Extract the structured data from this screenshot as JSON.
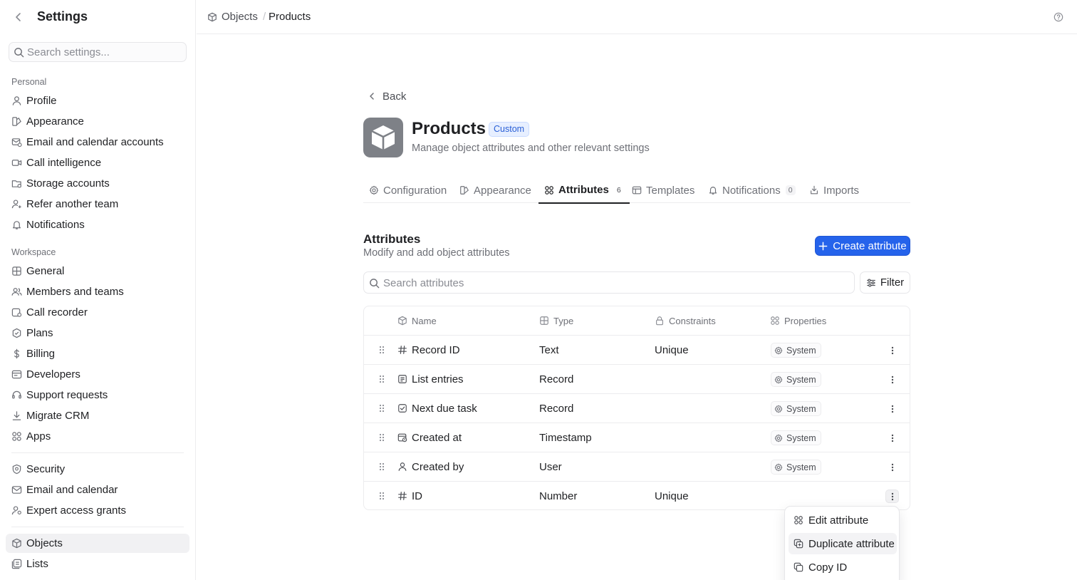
{
  "sidebar": {
    "title": "Settings",
    "search_placeholder": "Search settings...",
    "personal_label": "Personal",
    "workspace_label": "Workspace",
    "personal": [
      {
        "label": "Profile",
        "icon": "user-icon"
      },
      {
        "label": "Appearance",
        "icon": "palette-icon"
      },
      {
        "label": "Email and calendar accounts",
        "icon": "mail-calendar-icon"
      },
      {
        "label": "Call intelligence",
        "icon": "video-icon"
      },
      {
        "label": "Storage accounts",
        "icon": "storage-icon"
      },
      {
        "label": "Refer another team",
        "icon": "user-plus-icon"
      },
      {
        "label": "Notifications",
        "icon": "bell-icon"
      }
    ],
    "workspace": [
      {
        "label": "General",
        "icon": "grid-icon"
      },
      {
        "label": "Members and teams",
        "icon": "users-icon"
      },
      {
        "label": "Call recorder",
        "icon": "recorder-icon"
      },
      {
        "label": "Plans",
        "icon": "badge-icon"
      },
      {
        "label": "Billing",
        "icon": "dollar-icon"
      },
      {
        "label": "Developers",
        "icon": "terminal-icon"
      },
      {
        "label": "Support requests",
        "icon": "headset-icon"
      },
      {
        "label": "Migrate CRM",
        "icon": "download-icon"
      },
      {
        "label": "Apps",
        "icon": "apps-icon"
      }
    ],
    "security": [
      {
        "label": "Security",
        "icon": "shield-icon"
      },
      {
        "label": "Email and calendar",
        "icon": "envelope-icon"
      },
      {
        "label": "Expert access grants",
        "icon": "user-key-icon"
      }
    ],
    "data": [
      {
        "label": "Objects",
        "icon": "cube-icon",
        "active": true
      },
      {
        "label": "Lists",
        "icon": "list-icon"
      }
    ]
  },
  "topbar": {
    "crumb_1": "Objects",
    "crumb_sep": "/",
    "crumb_2": "Products"
  },
  "page": {
    "back": "Back",
    "title": "Products",
    "badge": "Custom",
    "subtitle": "Manage object attributes and other relevant settings",
    "tabs": [
      {
        "label": "Configuration",
        "icon": "gear-icon"
      },
      {
        "label": "Appearance",
        "icon": "palette-icon"
      },
      {
        "label": "Attributes",
        "icon": "attributes-icon",
        "count": "6",
        "active": true
      },
      {
        "label": "Templates",
        "icon": "template-icon"
      },
      {
        "label": "Notifications",
        "icon": "bell-icon",
        "count": "0"
      },
      {
        "label": "Imports",
        "icon": "import-icon"
      }
    ]
  },
  "attributes": {
    "title": "Attributes",
    "subtitle": "Modify and add object attributes",
    "create_label": "Create attribute",
    "search_placeholder": "Search attributes",
    "filter_label": "Filter",
    "columns": {
      "name": "Name",
      "type": "Type",
      "constraints": "Constraints",
      "properties": "Properties"
    },
    "rows": [
      {
        "name": "Record ID",
        "icon": "hash-icon",
        "type": "Text",
        "constraints": "Unique",
        "property": "System"
      },
      {
        "name": "List entries",
        "icon": "list-entry-icon",
        "type": "Record",
        "constraints": "",
        "property": "System"
      },
      {
        "name": "Next due task",
        "icon": "checkbox-icon",
        "type": "Record",
        "constraints": "",
        "property": "System"
      },
      {
        "name": "Created at",
        "icon": "calendar-clock-icon",
        "type": "Timestamp",
        "constraints": "",
        "property": "System"
      },
      {
        "name": "Created by",
        "icon": "user-icon",
        "type": "User",
        "constraints": "",
        "property": "System"
      },
      {
        "name": "ID",
        "icon": "hash-icon",
        "type": "Number",
        "constraints": "Unique",
        "property": ""
      }
    ]
  },
  "menu": {
    "items": [
      {
        "label": "Edit attribute",
        "icon": "attributes-icon"
      },
      {
        "label": "Duplicate attribute",
        "icon": "duplicate-icon",
        "hover": true
      },
      {
        "label": "Copy ID",
        "icon": "copy-icon"
      }
    ]
  },
  "colors": {
    "accent": "#2563eb",
    "badge_bg": "#e7efff",
    "badge_text": "#2a5fd6"
  }
}
